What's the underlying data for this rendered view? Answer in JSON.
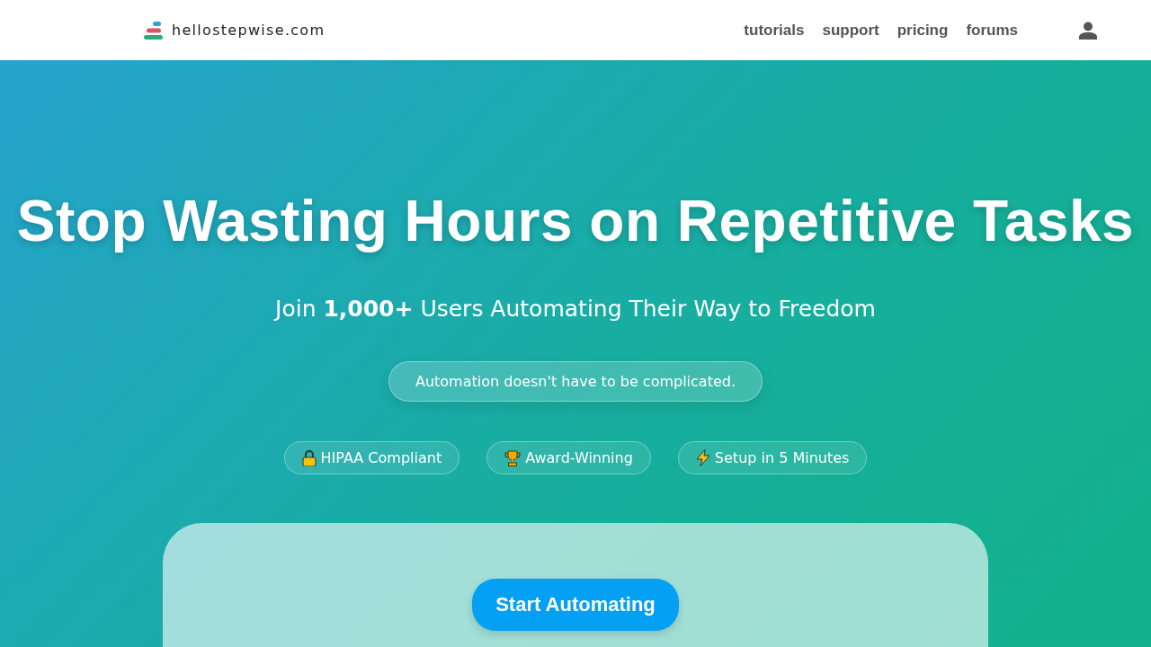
{
  "header": {
    "logo_text": "hellostepwise.com",
    "nav": [
      {
        "label": "tutorials"
      },
      {
        "label": "support"
      },
      {
        "label": "pricing"
      },
      {
        "label": "forums"
      }
    ]
  },
  "hero": {
    "title": "Stop Wasting Hours on Repetitive Tasks",
    "subtitle": "Join **1,000+** Users Automating Their Way to Freedom",
    "tagline": "Automation doesn't have to be complicated.",
    "badges": [
      {
        "kind": "lock",
        "label": "HIPAA Compliant"
      },
      {
        "kind": "trophy",
        "label": "Award-Winning"
      },
      {
        "kind": "bolt",
        "label": "Setup in 5 Minutes"
      }
    ],
    "cta": {
      "label": "Start Automating"
    }
  }
}
